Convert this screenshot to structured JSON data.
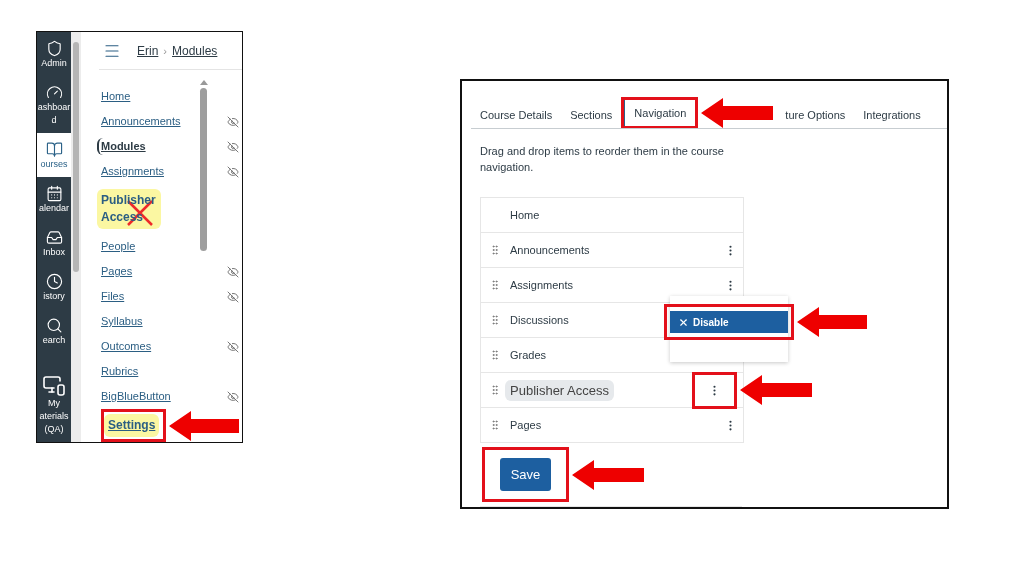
{
  "left_screenshot": {
    "global_nav": [
      {
        "label": "Admin",
        "selected": false
      },
      {
        "label": "ashboar d",
        "selected": false
      },
      {
        "label": "ourses",
        "selected": true
      },
      {
        "label": "alendar",
        "selected": false
      },
      {
        "label": "Inbox",
        "selected": false
      },
      {
        "label": "istory",
        "selected": false
      },
      {
        "label": "earch",
        "selected": false
      },
      {
        "label": "My aterials (QA)",
        "selected": false
      }
    ],
    "breadcrumb": {
      "items": [
        "Erin",
        "Modules"
      ],
      "separator": "›"
    },
    "course_nav": [
      {
        "label": "Home",
        "hidden": false,
        "selected": false,
        "highlighted": false,
        "crossed": false,
        "annotated": false
      },
      {
        "label": "Announcements",
        "hidden": true,
        "selected": false,
        "highlighted": false,
        "crossed": false,
        "annotated": false
      },
      {
        "label": "Modules",
        "hidden": true,
        "selected": true,
        "highlighted": false,
        "crossed": false,
        "annotated": false
      },
      {
        "label": "Assignments",
        "hidden": true,
        "selected": false,
        "highlighted": false,
        "crossed": false,
        "annotated": false
      },
      {
        "label": "Publisher Access",
        "hidden": false,
        "selected": false,
        "highlighted": true,
        "crossed": true,
        "annotated": false
      },
      {
        "label": "People",
        "hidden": false,
        "selected": false,
        "highlighted": false,
        "crossed": false,
        "annotated": false
      },
      {
        "label": "Pages",
        "hidden": true,
        "selected": false,
        "highlighted": false,
        "crossed": false,
        "annotated": false
      },
      {
        "label": "Files",
        "hidden": true,
        "selected": false,
        "highlighted": false,
        "crossed": false,
        "annotated": false
      },
      {
        "label": "Syllabus",
        "hidden": false,
        "selected": false,
        "highlighted": false,
        "crossed": false,
        "annotated": false
      },
      {
        "label": "Outcomes",
        "hidden": true,
        "selected": false,
        "highlighted": false,
        "crossed": false,
        "annotated": false
      },
      {
        "label": "Rubrics",
        "hidden": false,
        "selected": false,
        "highlighted": false,
        "crossed": false,
        "annotated": false
      },
      {
        "label": "BigBlueButton",
        "hidden": true,
        "selected": false,
        "highlighted": false,
        "crossed": false,
        "annotated": false
      },
      {
        "label": "Settings",
        "hidden": false,
        "selected": false,
        "highlighted": true,
        "crossed": false,
        "annotated": true
      }
    ]
  },
  "right_screenshot": {
    "tabs": [
      {
        "label": "Course Details",
        "selected": false,
        "annotated": false
      },
      {
        "label": "Sections",
        "selected": false,
        "annotated": false
      },
      {
        "label": "Navigation",
        "selected": true,
        "annotated": true
      },
      {
        "label": "ture Options",
        "selected": false,
        "annotated": false
      },
      {
        "label": "Integrations",
        "selected": false,
        "annotated": false
      }
    ],
    "description": "Drag and drop items to reorder them in the course navigation.",
    "nav_items": [
      {
        "label": "Home",
        "draggable": false,
        "menu": false,
        "highlighted": false,
        "menu_annotated": false
      },
      {
        "label": "Announcements",
        "draggable": true,
        "menu": true,
        "highlighted": false,
        "menu_annotated": false
      },
      {
        "label": "Assignments",
        "draggable": true,
        "menu": true,
        "highlighted": false,
        "menu_annotated": false
      },
      {
        "label": "Discussions",
        "draggable": true,
        "menu": false,
        "highlighted": false,
        "menu_annotated": false
      },
      {
        "label": "Grades",
        "draggable": true,
        "menu": false,
        "highlighted": false,
        "menu_annotated": false
      },
      {
        "label": "Publisher Access",
        "draggable": true,
        "menu": true,
        "highlighted": true,
        "menu_annotated": true
      },
      {
        "label": "Pages",
        "draggable": true,
        "menu": true,
        "highlighted": false,
        "menu_annotated": false
      }
    ],
    "menu": {
      "items": [
        {
          "label": "Disable",
          "selected": true,
          "annotated": true
        }
      ]
    },
    "save_button": {
      "label": "Save",
      "annotated": true
    }
  }
}
